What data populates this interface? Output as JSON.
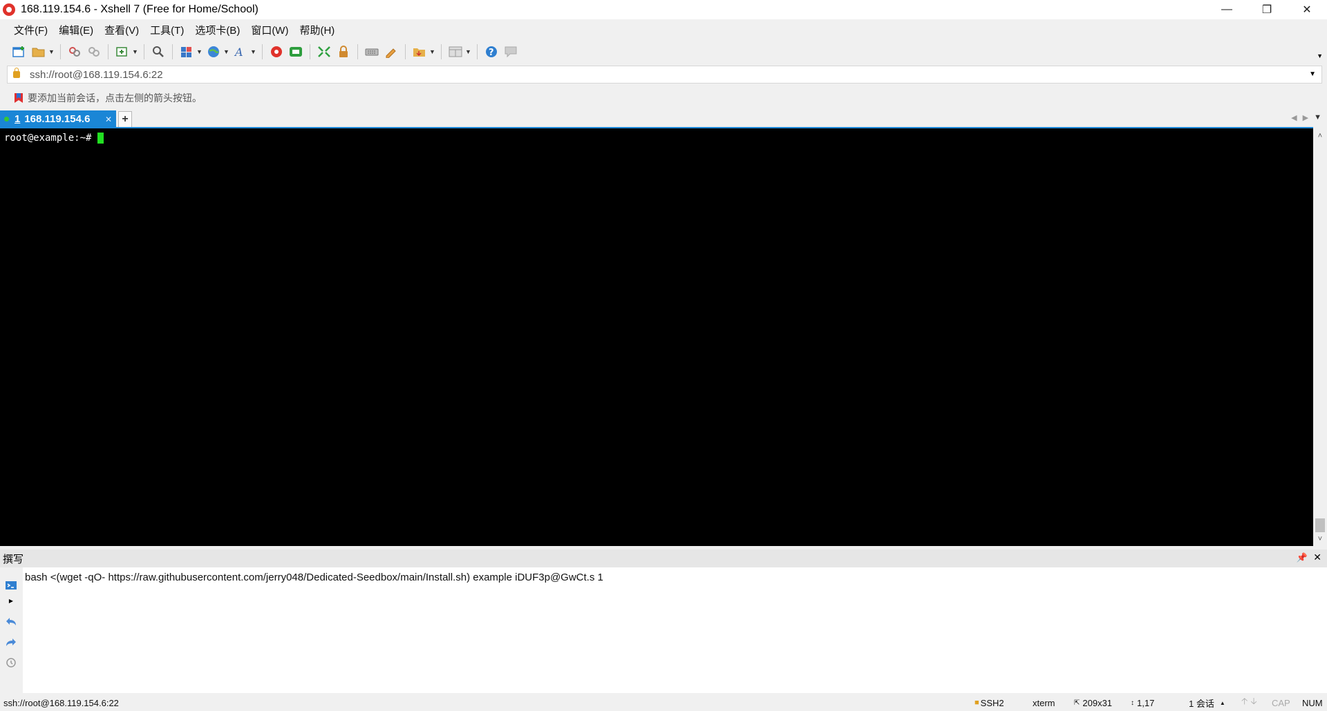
{
  "window": {
    "title": "168.119.154.6 - Xshell 7 (Free for Home/School)",
    "controls": [
      "minimize",
      "restore",
      "close"
    ]
  },
  "menu": [
    "文件(F)",
    "编辑(E)",
    "查看(V)",
    "工具(T)",
    "选项卡(B)",
    "窗口(W)",
    "帮助(H)"
  ],
  "toolbar": {
    "icons": [
      "new-session-icon",
      "open-folder-icon",
      "reconnect-icon",
      "disconnect-icon",
      "new-window-icon",
      "find-icon",
      "layout-icon",
      "globe-icon",
      "font-icon",
      "xftp-icon",
      "xagent-icon",
      "fullscreen-icon",
      "lock-icon",
      "keyboard-icon",
      "compose-icon",
      "transfer-icon",
      "layout-grid-icon",
      "help-icon",
      "chat-icon"
    ]
  },
  "address": {
    "value": "ssh://root@168.119.154.6:22"
  },
  "hint": {
    "text": "要添加当前会话，点击左侧的箭头按钮。"
  },
  "tabs": [
    {
      "index": "1",
      "label": "168.119.154.6",
      "status": "connected"
    }
  ],
  "terminal": {
    "prompt": "root@example:~#"
  },
  "compose": {
    "title": "撰写",
    "text": "bash <(wget -qO- https://raw.githubusercontent.com/jerry048/Dedicated-Seedbox/main/Install.sh) example iDUF3p@GwCt.s 1"
  },
  "status": {
    "connection": "ssh://root@168.119.154.6:22",
    "protocol": "SSH2",
    "terminal_type": "xterm",
    "size": "209x31",
    "cursor_pos": "1,17",
    "sessions": "1 会话",
    "cap": "CAP",
    "num": "NUM"
  },
  "colors": {
    "tab_active": "#1a86d6",
    "terminal_bg": "#000000",
    "cursor": "#22e022",
    "logo": "#e0322b"
  }
}
